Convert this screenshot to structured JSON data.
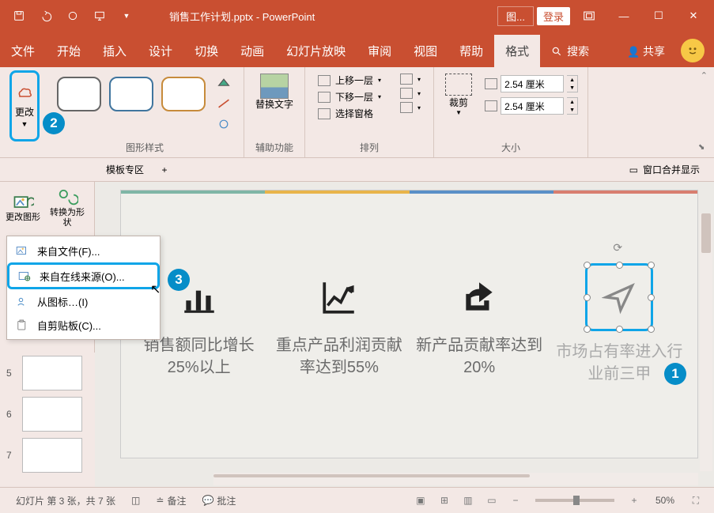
{
  "titlebar": {
    "filename": "销售工作计划.pptx",
    "app": "PowerPoint",
    "picture_tools": "图...",
    "login": "登录"
  },
  "menubar": {
    "tabs": [
      "文件",
      "开始",
      "插入",
      "设计",
      "切换",
      "动画",
      "幻灯片放映",
      "审阅",
      "视图",
      "帮助",
      "格式"
    ],
    "active_index": 10,
    "search_label": "搜索",
    "share_label": "共享"
  },
  "ribbon": {
    "change_label": "更改",
    "shape_styles_label": "图形样式",
    "replace_text": "替换文字",
    "accessibility_label": "辅助功能",
    "arrange": {
      "bring_forward": "上移一层",
      "send_backward": "下移一层",
      "selection_pane": "选择窗格",
      "label": "排列"
    },
    "crop_label": "裁剪",
    "size": {
      "height": "2.54 厘米",
      "width": "2.54 厘米",
      "label": "大小"
    }
  },
  "tabstrip": {
    "template_area": "模板专区",
    "add": "+",
    "window_merge": "窗口合并显示"
  },
  "left_tools": {
    "change_image": "更改图形",
    "convert_shape": "转换为形状"
  },
  "dropdown": {
    "from_file": "来自文件(F)...",
    "from_online": "来自在线来源(O)...",
    "from_icon": "从图标…(I)",
    "from_clipboard": "自剪贴板(C)..."
  },
  "slide": {
    "items": [
      {
        "text": "销售额同比增长25%以上"
      },
      {
        "text": "重点产品利润贡献率达到55%"
      },
      {
        "text": "新产品贡献率达到20%"
      },
      {
        "text": "市场占有率进入行业前三甲"
      }
    ]
  },
  "thumbs": {
    "slide5": "5",
    "slide6": "6",
    "slide7": "7"
  },
  "statusbar": {
    "slide_status": "幻灯片 第 3 张，共 7 张",
    "notes": "备注",
    "comments": "批注",
    "zoom": "50%"
  },
  "badges": {
    "one": "1",
    "two": "2",
    "three": "3"
  }
}
